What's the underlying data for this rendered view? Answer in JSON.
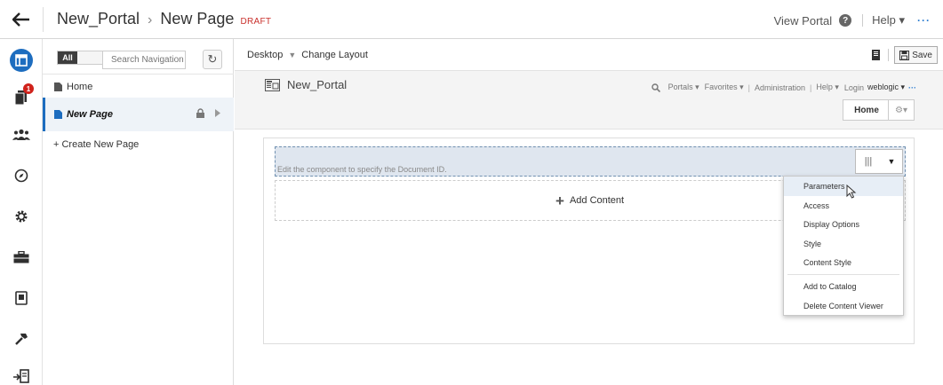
{
  "header": {
    "breadcrumb": [
      "New_Portal",
      "New Page"
    ],
    "breadcrumb_sep": "›",
    "status_badge": "DRAFT",
    "view_portal": "View Portal",
    "help": "Help ▾",
    "more": "···"
  },
  "rail": {
    "notification_count": "1"
  },
  "nav": {
    "filter_label": "All",
    "search_placeholder": "Search Navigation",
    "items": [
      {
        "label": "Home"
      },
      {
        "label": "New Page"
      }
    ],
    "create_label": "+ Create New Page"
  },
  "toolbar": {
    "device": "Desktop",
    "change_layout": "Change Layout",
    "save": "Save"
  },
  "portal": {
    "name": "New_Portal",
    "links": {
      "portals": "Portals ▾",
      "favorites": "Favorites ▾",
      "administration": "Administration",
      "help": "Help ▾",
      "login": "Login",
      "user": "weblogic ▾",
      "more": "···"
    },
    "home_tab": "Home",
    "gear_tab": "⚙▾"
  },
  "component": {
    "hint": "Edit the component to specify the Document ID.",
    "add_content": "Add Content"
  },
  "menu": {
    "items": [
      "Parameters",
      "Access",
      "Display Options",
      "Style",
      "Content Style",
      "Add to Catalog",
      "Delete Content Viewer"
    ]
  },
  "colors": {
    "accent": "#1d6dbf",
    "draft": "#c9302c",
    "badge": "#d0221b",
    "component_bg": "#dfe6ef"
  }
}
